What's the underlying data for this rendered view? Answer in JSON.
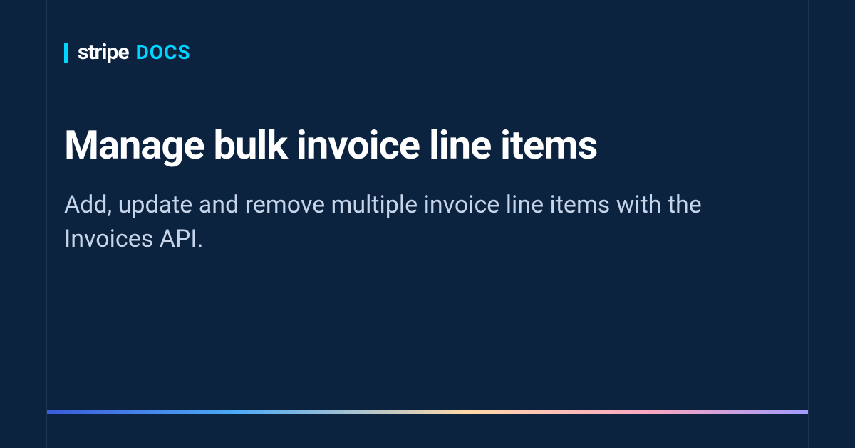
{
  "header": {
    "brand": "stripe",
    "section": "DOCS"
  },
  "page": {
    "title": "Manage bulk invoice line items",
    "subtitle": "Add, update and remove multiple invoice line items with the Invoices API."
  }
}
